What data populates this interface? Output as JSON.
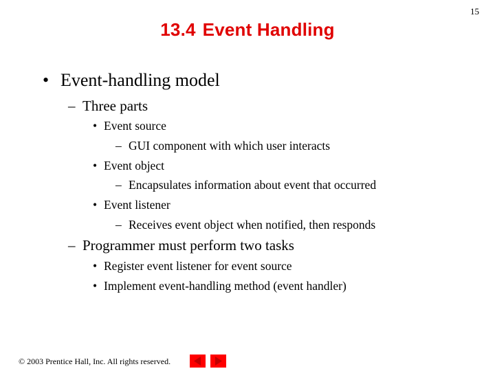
{
  "slide": {
    "page_number": "15",
    "title_number": "13.4",
    "title_text": "Event Handling",
    "bullets": {
      "main": "Event-handling model",
      "three_parts": "Three parts",
      "source": "Event source",
      "source_desc": "GUI component with which user interacts",
      "object": "Event object",
      "object_desc": "Encapsulates information about event that occurred",
      "listener": "Event listener",
      "listener_desc": "Receives event object when notified, then responds",
      "programmer": "Programmer must perform two tasks",
      "register": "Register event listener for event source",
      "implement": "Implement event-handling method (event handler)"
    },
    "markers": {
      "bullet": "•",
      "dash": "–"
    }
  },
  "footer": {
    "copyright_symbol": "©",
    "copyright_text": "2003 Prentice Hall, Inc.  All rights reserved."
  },
  "nav": {
    "prev_icon": "left-arrow-icon",
    "next_icon": "right-arrow-icon",
    "button_color": "#ff0000",
    "arrow_color": "#c00000"
  }
}
